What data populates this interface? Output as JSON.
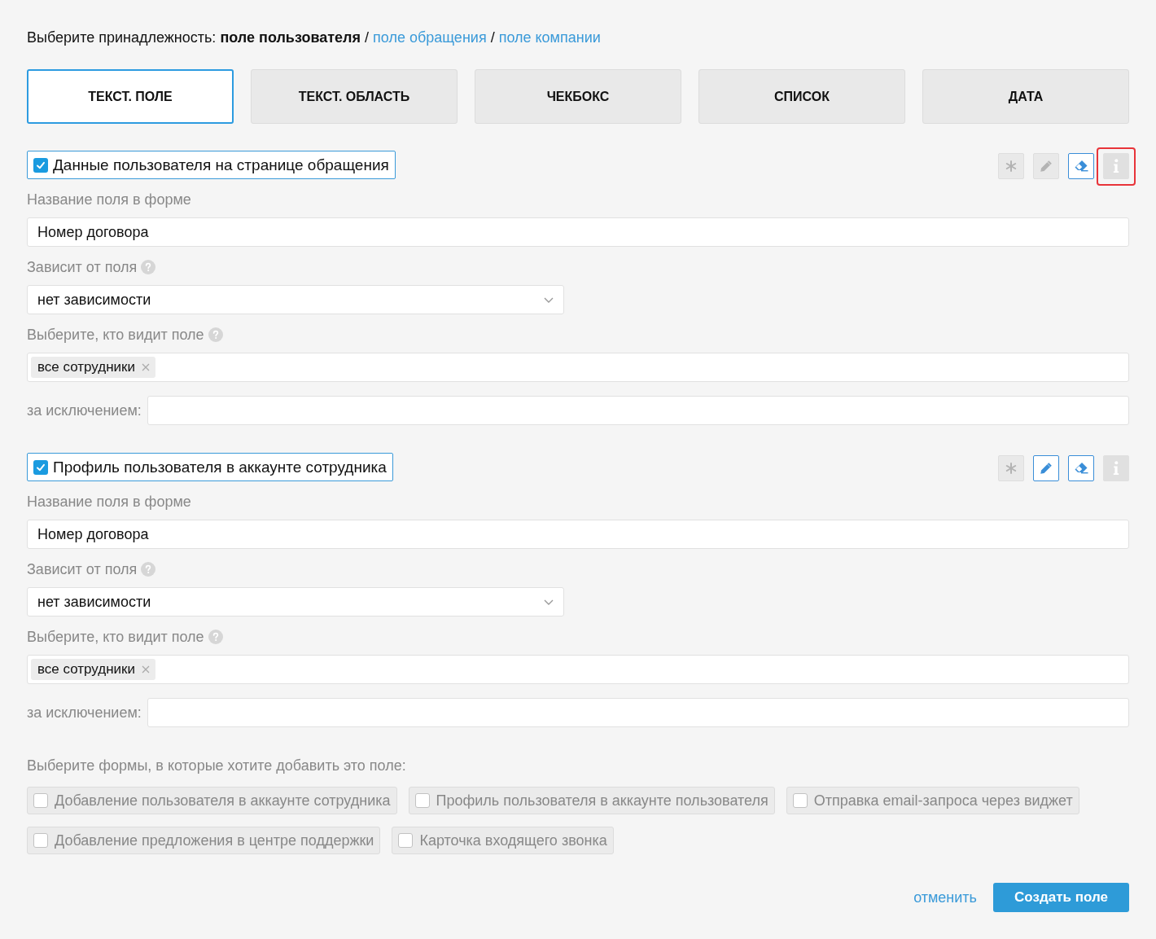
{
  "belonging": {
    "label": "Выберите принадлежность:",
    "separator": "/",
    "options": [
      {
        "label": "поле пользователя",
        "selected": true
      },
      {
        "label": "поле обращения",
        "selected": false
      },
      {
        "label": "поле компании",
        "selected": false
      }
    ]
  },
  "tabs": [
    {
      "label": "ТЕКСТ. ПОЛЕ",
      "selected": true
    },
    {
      "label": "ТЕКСТ. ОБЛАСТЬ",
      "selected": false
    },
    {
      "label": "ЧЕКБОКС",
      "selected": false
    },
    {
      "label": "СПИСОК",
      "selected": false
    },
    {
      "label": "ДАТА",
      "selected": false
    }
  ],
  "sections": [
    {
      "checked": true,
      "title": "Данные пользователя на странице обращения",
      "tools": [
        {
          "kind": "asterisk",
          "active": false,
          "highlighted": false
        },
        {
          "kind": "pencil",
          "active": false,
          "highlighted": false
        },
        {
          "kind": "eraser",
          "active": true,
          "highlighted": false
        },
        {
          "kind": "info",
          "active": false,
          "highlighted": true
        }
      ],
      "name_label": "Название поля в форме",
      "name_value": "Номер договора",
      "dependency_label": "Зависит от поля",
      "dependency_value": "нет зависимости",
      "visibility_label": "Выберите, кто видит поле",
      "visibility_tags": [
        "все сотрудники"
      ],
      "exception_label": "за исключением:"
    },
    {
      "checked": true,
      "title": "Профиль пользователя в аккаунте сотрудника",
      "tools": [
        {
          "kind": "asterisk",
          "active": false,
          "highlighted": false
        },
        {
          "kind": "pencil",
          "active": true,
          "highlighted": false
        },
        {
          "kind": "eraser",
          "active": true,
          "highlighted": false
        },
        {
          "kind": "info",
          "active": false,
          "highlighted": false
        }
      ],
      "name_label": "Название поля в форме",
      "name_value": "Номер договора",
      "dependency_label": "Зависит от поля",
      "dependency_value": "нет зависимости",
      "visibility_label": "Выберите, кто видит поле",
      "visibility_tags": [
        "все сотрудники"
      ],
      "exception_label": "за исключением:"
    }
  ],
  "forms": {
    "label": "Выберите формы, в которые хотите добавить это поле:",
    "options": [
      {
        "label": "Добавление пользователя в аккаунте сотрудника",
        "checked": false
      },
      {
        "label": "Профиль пользователя в аккаунте пользователя",
        "checked": false
      },
      {
        "label": "Отправка email-запроса через виджет",
        "checked": false
      },
      {
        "label": "Добавление предложения в центре поддержки",
        "checked": false
      },
      {
        "label": "Карточка входящего звонка",
        "checked": false
      }
    ]
  },
  "actions": {
    "cancel": "отменить",
    "submit": "Создать поле"
  }
}
